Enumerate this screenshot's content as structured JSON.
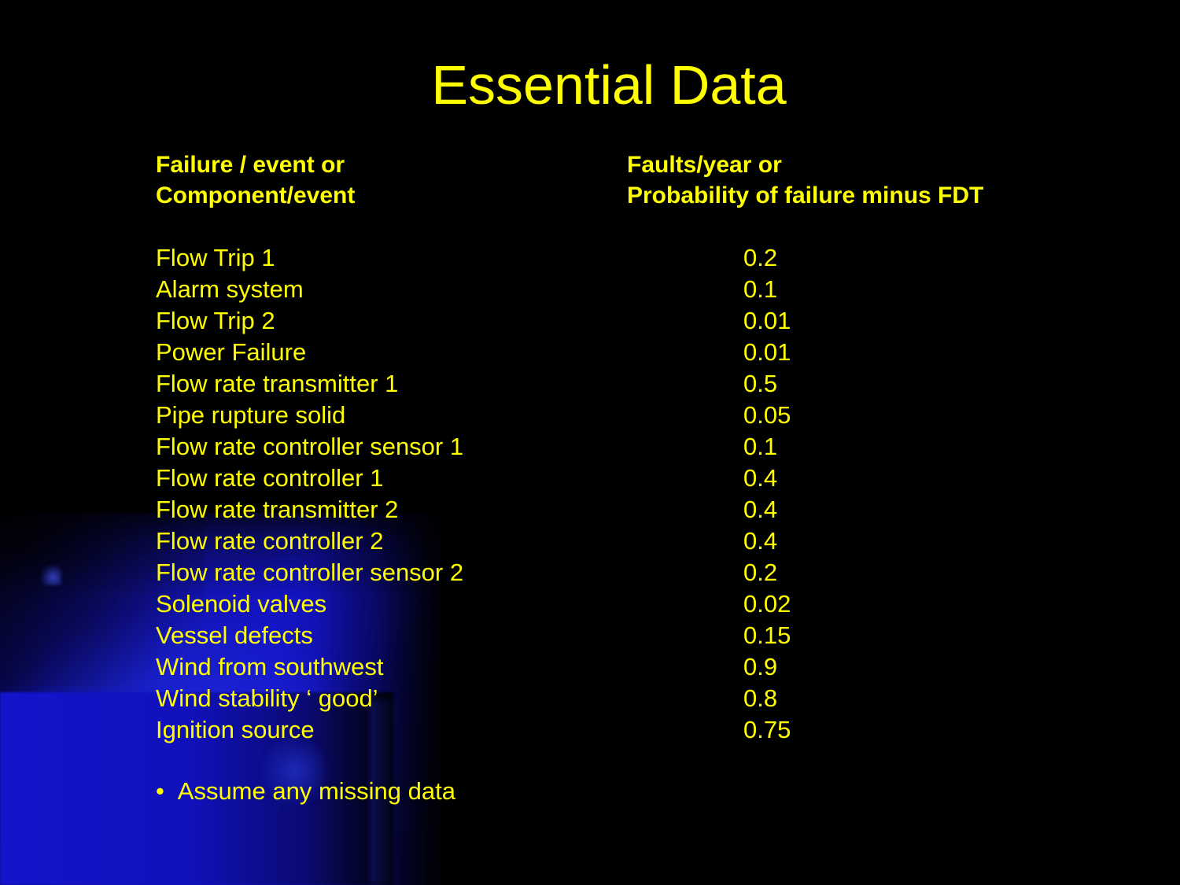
{
  "slide": {
    "title": "Essential Data",
    "background_color": "#000000",
    "text_color": "#ffff00",
    "accent_shape_color": "#1414c4"
  },
  "table": {
    "headers": {
      "left": [
        "Failure / event or",
        "Component/event"
      ],
      "right": [
        "Faults/year or",
        "Probability of failure minus FDT"
      ]
    },
    "rows": [
      {
        "name": "Flow Trip 1",
        "value": "0.2"
      },
      {
        "name": "Alarm system",
        "value": "0.1"
      },
      {
        "name": "Flow Trip 2",
        "value": "0.01"
      },
      {
        "name": "Power Failure",
        "value": "0.01"
      },
      {
        "name": "Flow rate transmitter 1",
        "value": "0.5"
      },
      {
        "name": "Pipe rupture solid",
        "value": "0.05"
      },
      {
        "name": "Flow rate controller sensor 1",
        "value": "0.1"
      },
      {
        "name": "Flow rate controller 1",
        "value": "0.4"
      },
      {
        "name": "Flow rate transmitter 2",
        "value": "0.4"
      },
      {
        "name": "Flow rate controller 2",
        "value": "0.4"
      },
      {
        "name": "Flow rate controller sensor 2",
        "value": "0.2"
      },
      {
        "name": "Solenoid valves",
        "value": "0.02"
      },
      {
        "name": "Vessel defects",
        "value": "0.15"
      },
      {
        "name": "Wind from southwest",
        "value": "0.9"
      },
      {
        "name": "Wind stability ‘ good’",
        "value": "0.8"
      },
      {
        "name": "Ignition source",
        "value": "0.75"
      }
    ]
  },
  "notes": {
    "bullet_glyph": "•",
    "bullet_text": "Assume any missing data"
  }
}
